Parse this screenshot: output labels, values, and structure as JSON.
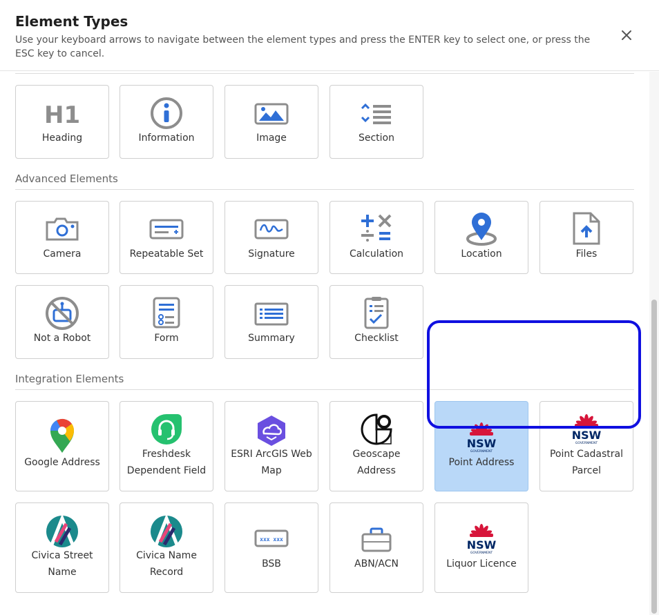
{
  "dialog": {
    "title": "Element Types",
    "subtitle": "Use your keyboard arrows to navigate between the element types and press the ENTER key to select one, or press the ESC key to cancel."
  },
  "sections": {
    "advanced": "Advanced Elements",
    "integration": "Integration Elements"
  },
  "tiles": {
    "heading": {
      "label": "Heading",
      "icon": "h1-icon"
    },
    "information": {
      "label": "Information",
      "icon": "info-icon"
    },
    "image": {
      "label": "Image",
      "icon": "image-icon"
    },
    "section": {
      "label": "Section",
      "icon": "section-icon"
    },
    "camera": {
      "label": "Camera",
      "icon": "camera-icon"
    },
    "repeatable_set": {
      "label": "Repeatable Set",
      "icon": "repeatable-set-icon"
    },
    "signature": {
      "label": "Signature",
      "icon": "signature-icon"
    },
    "calculation": {
      "label": "Calculation",
      "icon": "calculation-icon"
    },
    "location": {
      "label": "Location",
      "icon": "location-pin-icon"
    },
    "files": {
      "label": "Files",
      "icon": "file-upload-icon"
    },
    "not_a_robot": {
      "label": "Not a Robot",
      "icon": "no-robot-icon"
    },
    "form": {
      "label": "Form",
      "icon": "form-icon"
    },
    "summary": {
      "label": "Summary",
      "icon": "summary-list-icon"
    },
    "checklist": {
      "label": "Checklist",
      "icon": "checklist-icon"
    },
    "google_address": {
      "label": "Google Address",
      "icon": "google-maps-icon"
    },
    "freshdesk": {
      "label": "Freshdesk Dependent Field",
      "icon": "freshdesk-icon"
    },
    "esri": {
      "label": "ESRI ArcGIS Web Map",
      "icon": "esri-icon"
    },
    "geoscape": {
      "label": "Geoscape Address",
      "icon": "geoscape-icon"
    },
    "point_address": {
      "label": "Point Address",
      "icon": "nsw-government-icon"
    },
    "point_cadastral": {
      "label": "Point Cadastral Parcel",
      "icon": "nsw-government-icon"
    },
    "civica_street": {
      "label": "Civica Street Name",
      "icon": "civica-icon"
    },
    "civica_name": {
      "label": "Civica Name Record",
      "icon": "civica-icon"
    },
    "bsb": {
      "label": "BSB",
      "icon": "bsb-icon"
    },
    "abn": {
      "label": "ABN/ACN",
      "icon": "briefcase-icon"
    },
    "liquor": {
      "label": "Liquor Licence",
      "icon": "nsw-government-icon"
    }
  },
  "icon_text": {
    "h1": "H1",
    "nsw": "NSW",
    "government": "GOVERNMENT",
    "bsb_mask": "xxx xxx"
  },
  "colors": {
    "accent_blue": "#2f6fd6",
    "icon_grey": "#8d8d8d",
    "selected_tile": "#b9d8f8",
    "highlight_ring": "#1010e0",
    "nsw_red": "#d7153a",
    "nsw_navy": "#002664",
    "freshdesk_green": "#25c16f",
    "esri_purple": "#6a4fe0",
    "civica_teal": "#1b8a8c"
  }
}
